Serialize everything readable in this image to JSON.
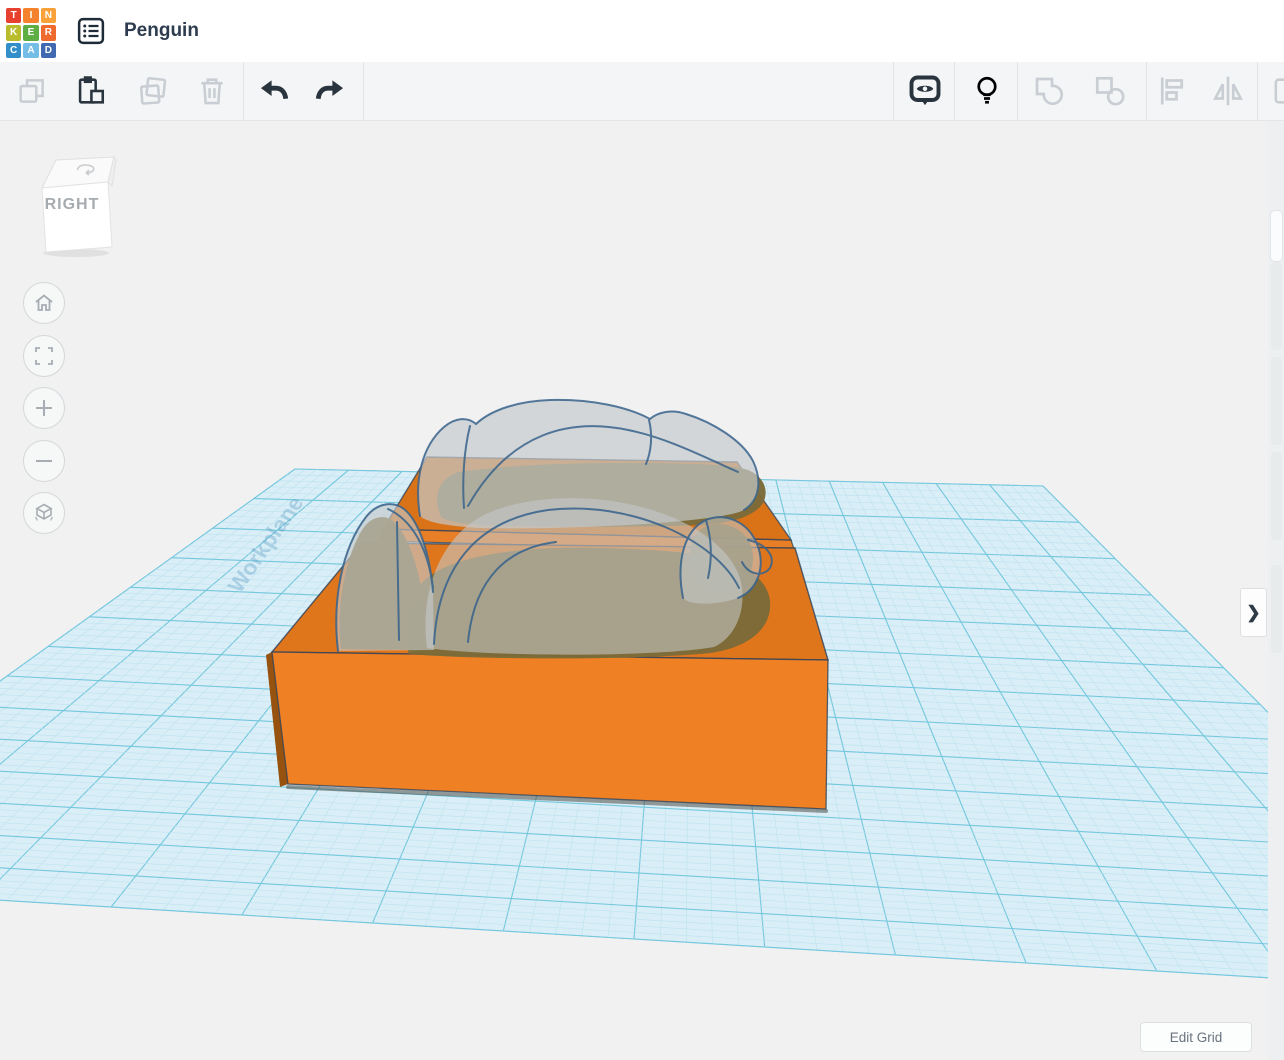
{
  "app": {
    "name": "Tinkercad",
    "logo_tiles": [
      {
        "letter": "T",
        "color": "#E8402F"
      },
      {
        "letter": "I",
        "color": "#F5822C"
      },
      {
        "letter": "N",
        "color": "#F9A23B"
      },
      {
        "letter": "K",
        "color": "#B9BD2D"
      },
      {
        "letter": "E",
        "color": "#5FAE44"
      },
      {
        "letter": "R",
        "color": "#EF6A2E"
      },
      {
        "letter": "C",
        "color": "#338FC9"
      },
      {
        "letter": "A",
        "color": "#74BDE6"
      },
      {
        "letter": "D",
        "color": "#4069B1"
      }
    ]
  },
  "header": {
    "title": "Penguin"
  },
  "toolbar": {
    "left": [
      {
        "name": "copy",
        "enabled": false
      },
      {
        "name": "paste",
        "enabled": true
      },
      {
        "name": "duplicate",
        "enabled": false
      },
      {
        "name": "delete",
        "enabled": false
      },
      {
        "name": "undo",
        "enabled": true
      },
      {
        "name": "redo",
        "enabled": true
      }
    ],
    "right": [
      {
        "name": "show-all",
        "enabled": true
      },
      {
        "name": "hide",
        "enabled": false
      },
      {
        "name": "group",
        "enabled": false
      },
      {
        "name": "ungroup",
        "enabled": false
      },
      {
        "name": "align",
        "enabled": false
      },
      {
        "name": "mirror",
        "enabled": false
      }
    ]
  },
  "viewcube": {
    "front_label": "RIGHT"
  },
  "nav_buttons": [
    "home",
    "fit-view",
    "zoom-in",
    "zoom-out",
    "orthographic-toggle"
  ],
  "canvas": {
    "watermark": "Workplane",
    "edit_grid_label": "Edit Grid",
    "collapse_glyph": "❯",
    "grid_base_color": "#D9EEF7",
    "grid_minor_color": "#BCE2EF",
    "grid_major_color": "#74C7DD"
  },
  "scene": {
    "objects": [
      {
        "name": "mold-box-back",
        "type": "box",
        "color": "#DA7318"
      },
      {
        "name": "mold-box-front",
        "type": "box",
        "color": "#EF8023"
      },
      {
        "name": "penguin-hole-back",
        "type": "hole",
        "color": "#C5C9CB"
      },
      {
        "name": "penguin-hole-front",
        "type": "hole",
        "color": "#C5C9CB"
      }
    ],
    "hole_intersection_color": "#7B6B39",
    "outline_color": "#3A648C"
  }
}
